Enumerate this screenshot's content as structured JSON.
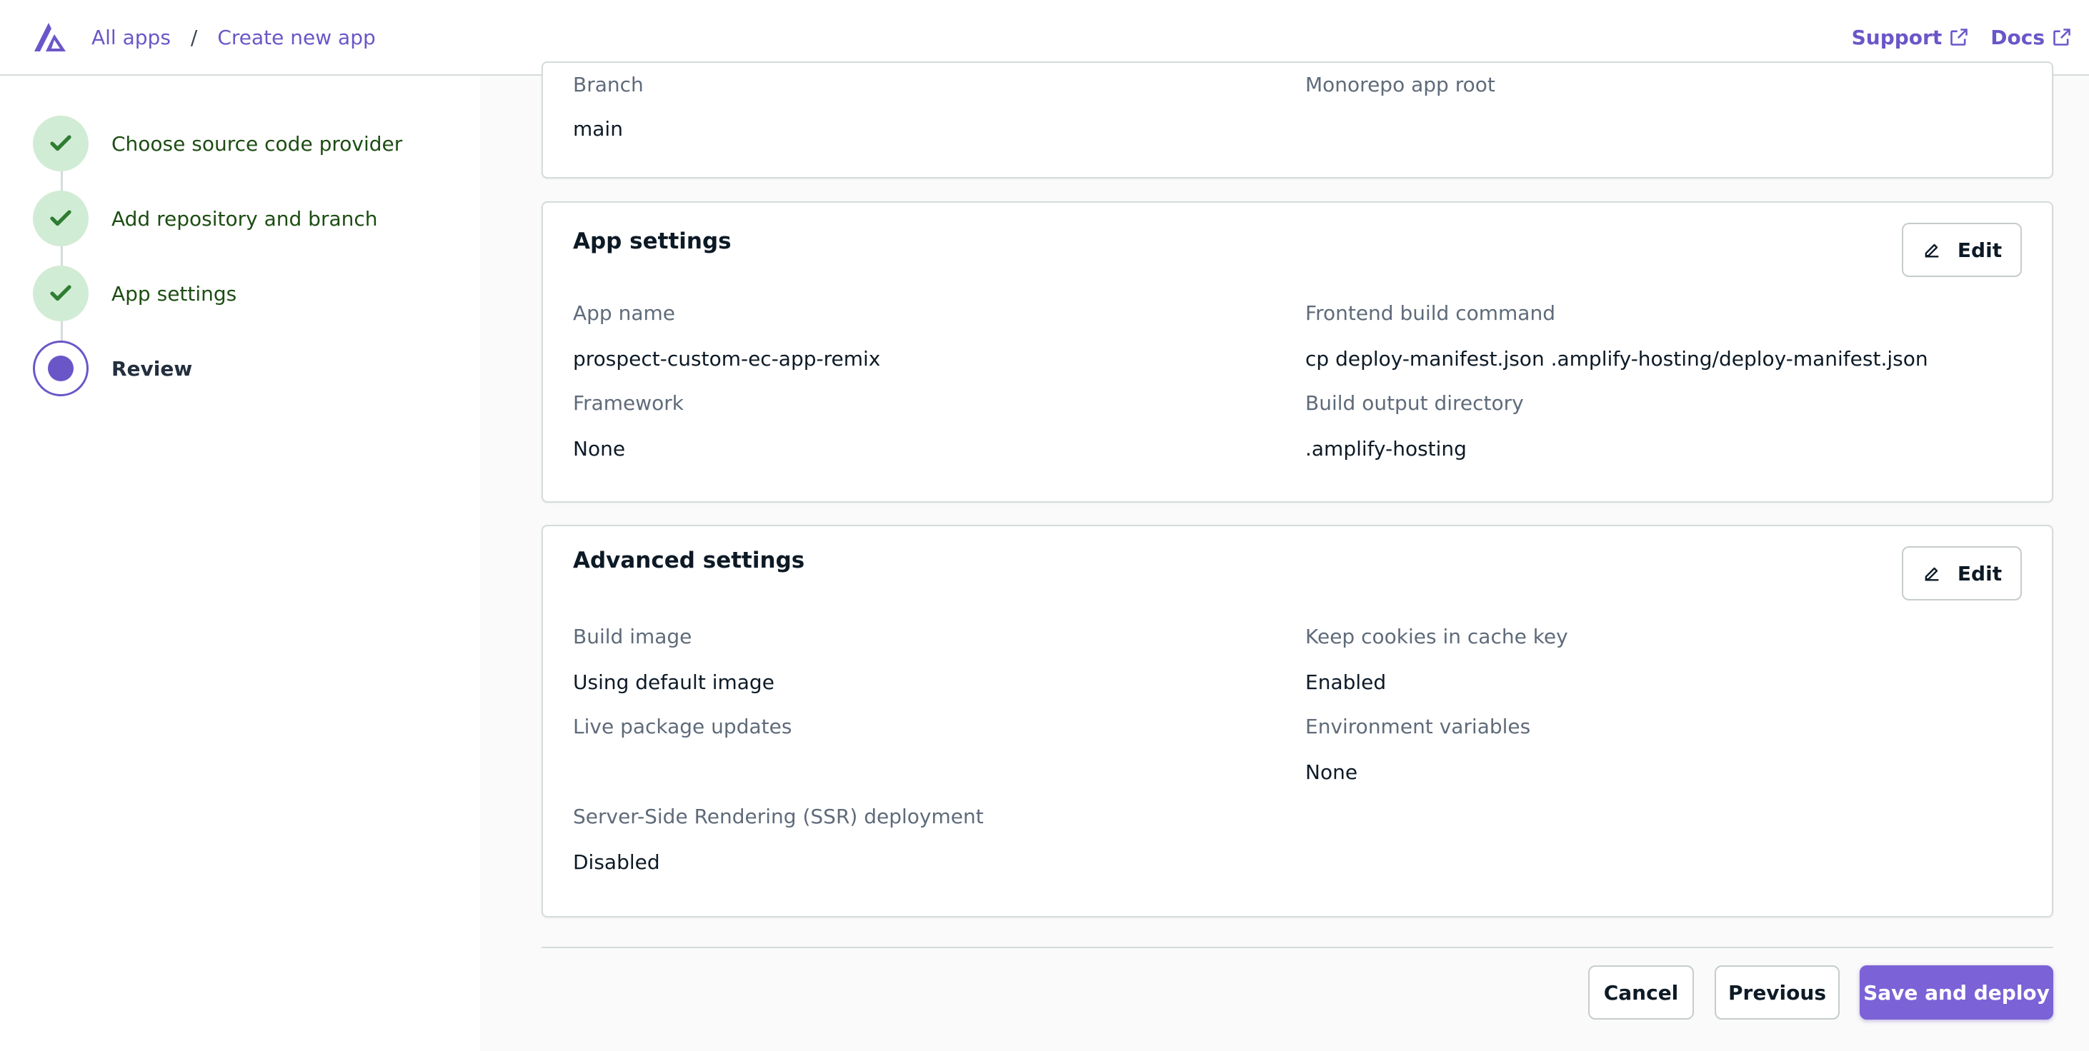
{
  "header": {
    "breadcrumb": [
      "All apps",
      "Create new app"
    ],
    "separator": "/",
    "links": [
      {
        "label": "Support",
        "icon": "external-link-icon"
      },
      {
        "label": "Docs",
        "icon": "external-link-icon"
      }
    ]
  },
  "steps": [
    {
      "label": "Choose source code provider",
      "status": "complete"
    },
    {
      "label": "Add repository and branch",
      "status": "complete"
    },
    {
      "label": "App settings",
      "status": "complete"
    },
    {
      "label": "Review",
      "status": "current"
    }
  ],
  "repo_card": {
    "fields": [
      {
        "label": "Branch",
        "value": "main"
      },
      {
        "label": "Monorepo app root",
        "value": ""
      }
    ]
  },
  "app_settings": {
    "title": "App settings",
    "edit_label": "Edit",
    "fields": [
      {
        "label": "App name",
        "value": "prospect-custom-ec-app-remix"
      },
      {
        "label": "Frontend build command",
        "value": "cp deploy-manifest.json .amplify-hosting/deploy-manifest.json"
      },
      {
        "label": "Framework",
        "value": "None"
      },
      {
        "label": "Build output directory",
        "value": ".amplify-hosting"
      }
    ]
  },
  "advanced_settings": {
    "title": "Advanced settings",
    "edit_label": "Edit",
    "fields": [
      {
        "label": "Build image",
        "value": "Using default image"
      },
      {
        "label": "Keep cookies in cache key",
        "value": "Enabled"
      },
      {
        "label": "Live package updates",
        "value": ""
      },
      {
        "label": "Environment variables",
        "value": "None"
      },
      {
        "label": "Server-Side Rendering (SSR) deployment",
        "value": "Disabled"
      }
    ]
  },
  "footer": {
    "cancel_label": "Cancel",
    "previous_label": "Previous",
    "save_label": "Save and deploy"
  },
  "colors": {
    "accent": "#6b56c8",
    "primary_button": "#7b62d6",
    "step_complete_bg": "#d1ecd4",
    "step_complete_check": "#2e7d32"
  }
}
